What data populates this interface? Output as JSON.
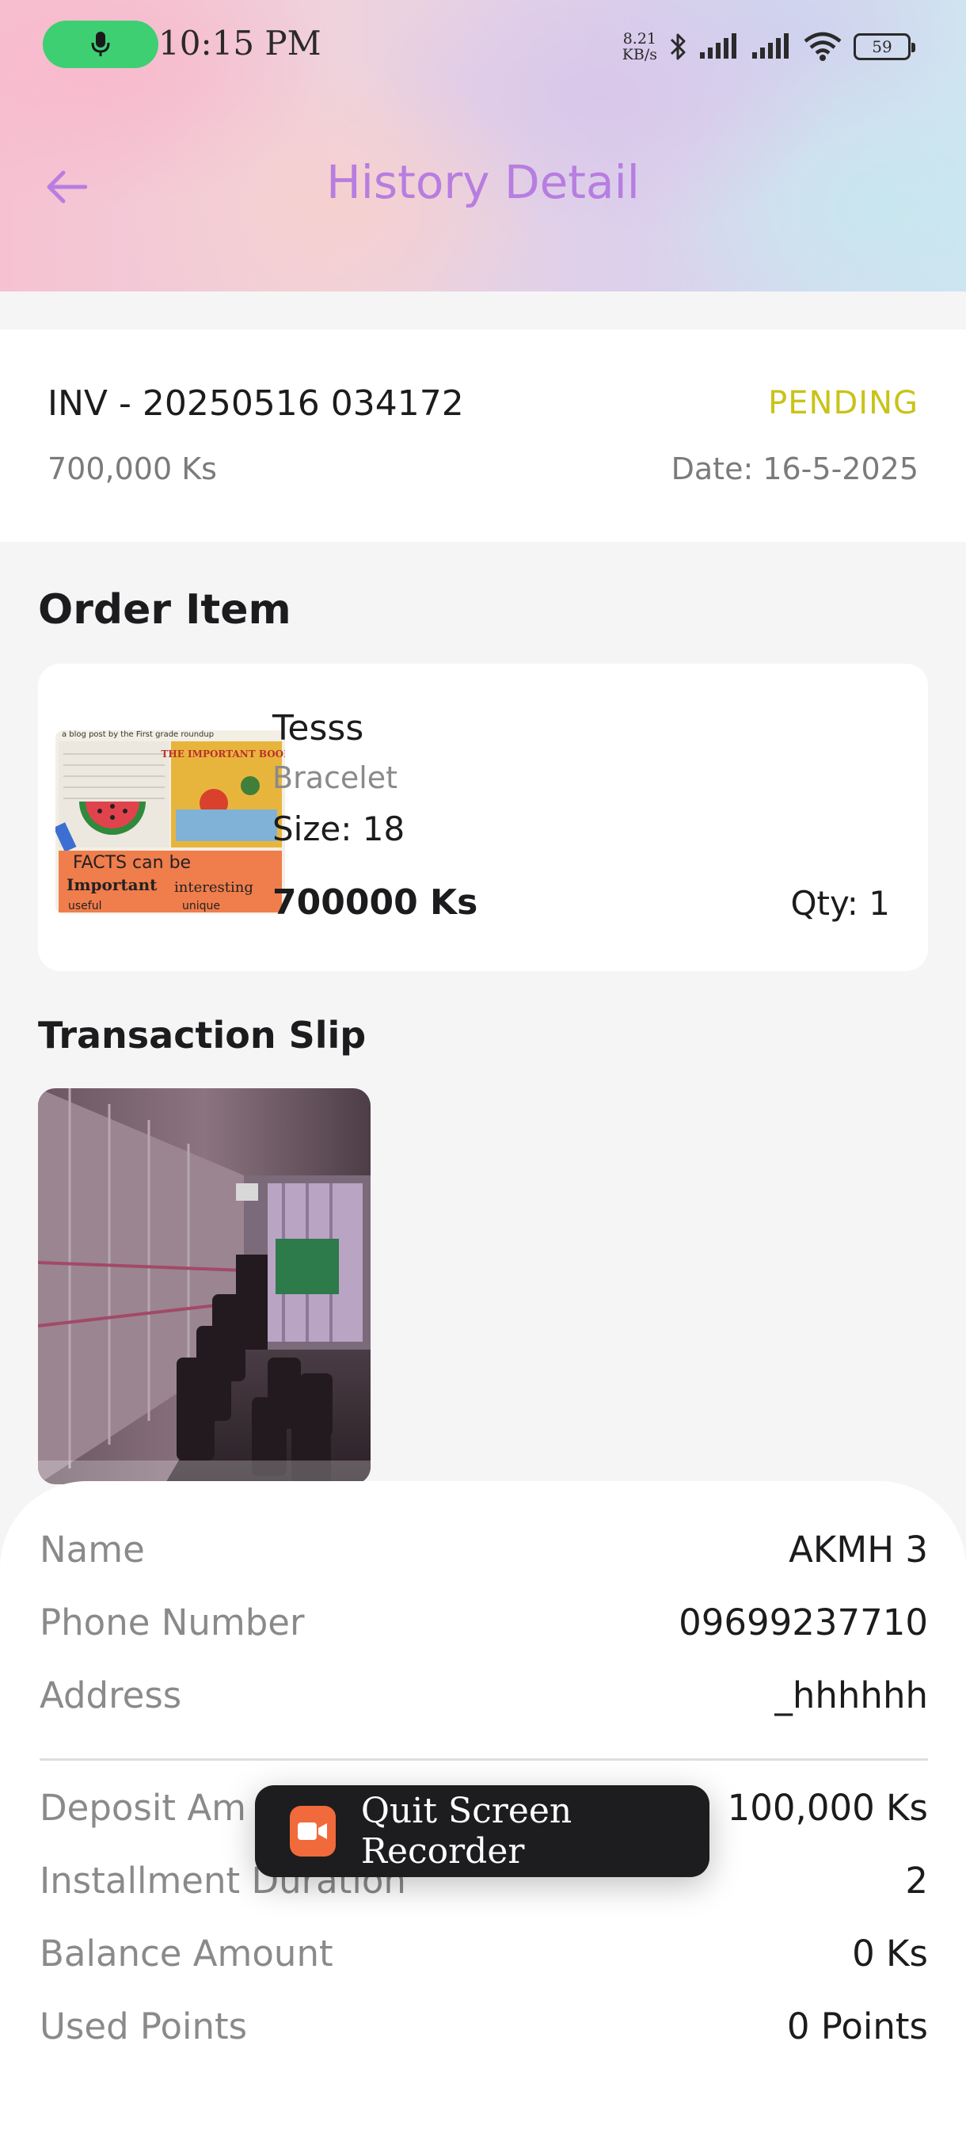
{
  "status_bar": {
    "time": "10:15 PM",
    "net_speed_value": "8.21",
    "net_speed_unit": "KB/s",
    "battery": "59"
  },
  "header": {
    "title": "History Detail"
  },
  "invoice": {
    "number": "INV - 20250516 034172",
    "status": "PENDING",
    "amount": "700,000 Ks",
    "date": "Date: 16-5-2025"
  },
  "order": {
    "section_title": "Order Item",
    "item": {
      "name": "Tesss",
      "category": "Bracelet",
      "size": "Size: 18",
      "price": "700000 Ks",
      "qty": "Qty: 1",
      "thumb_caption": "a blog post by the First grade roundup",
      "thumb_book": "THE IMPORTANT BOOK",
      "thumb_text_1": "FACTS can be",
      "thumb_text_2": "Important",
      "thumb_text_3": "interesting",
      "thumb_text_4": "useful",
      "thumb_text_5": "unique"
    }
  },
  "transaction": {
    "section_title": "Transaction Slip"
  },
  "details": {
    "name_label": "Name",
    "name_value": "AKMH 3",
    "phone_label": "Phone Number",
    "phone_value": "09699237710",
    "address_label": "Address",
    "address_value": "_hhhhhh",
    "deposit_label": "Deposit Am",
    "deposit_value": "100,000 Ks",
    "installment_label": "Installment Duration",
    "installment_value": "2",
    "balance_label": "Balance Amount",
    "balance_value": "0 Ks",
    "points_label": "Used Points",
    "points_value": "0 Points"
  },
  "toast": {
    "label": "Quit Screen Recorder"
  },
  "colors": {
    "title": "#b77de0",
    "status_pending": "#c9c318",
    "mic_pill": "#3ecf73",
    "recorder_icon": "#f06a3b"
  },
  "icons": [
    "mic-icon",
    "bluetooth-icon",
    "signal-icon",
    "wifi-icon",
    "battery-icon",
    "back-arrow-icon",
    "video-camera-icon"
  ]
}
